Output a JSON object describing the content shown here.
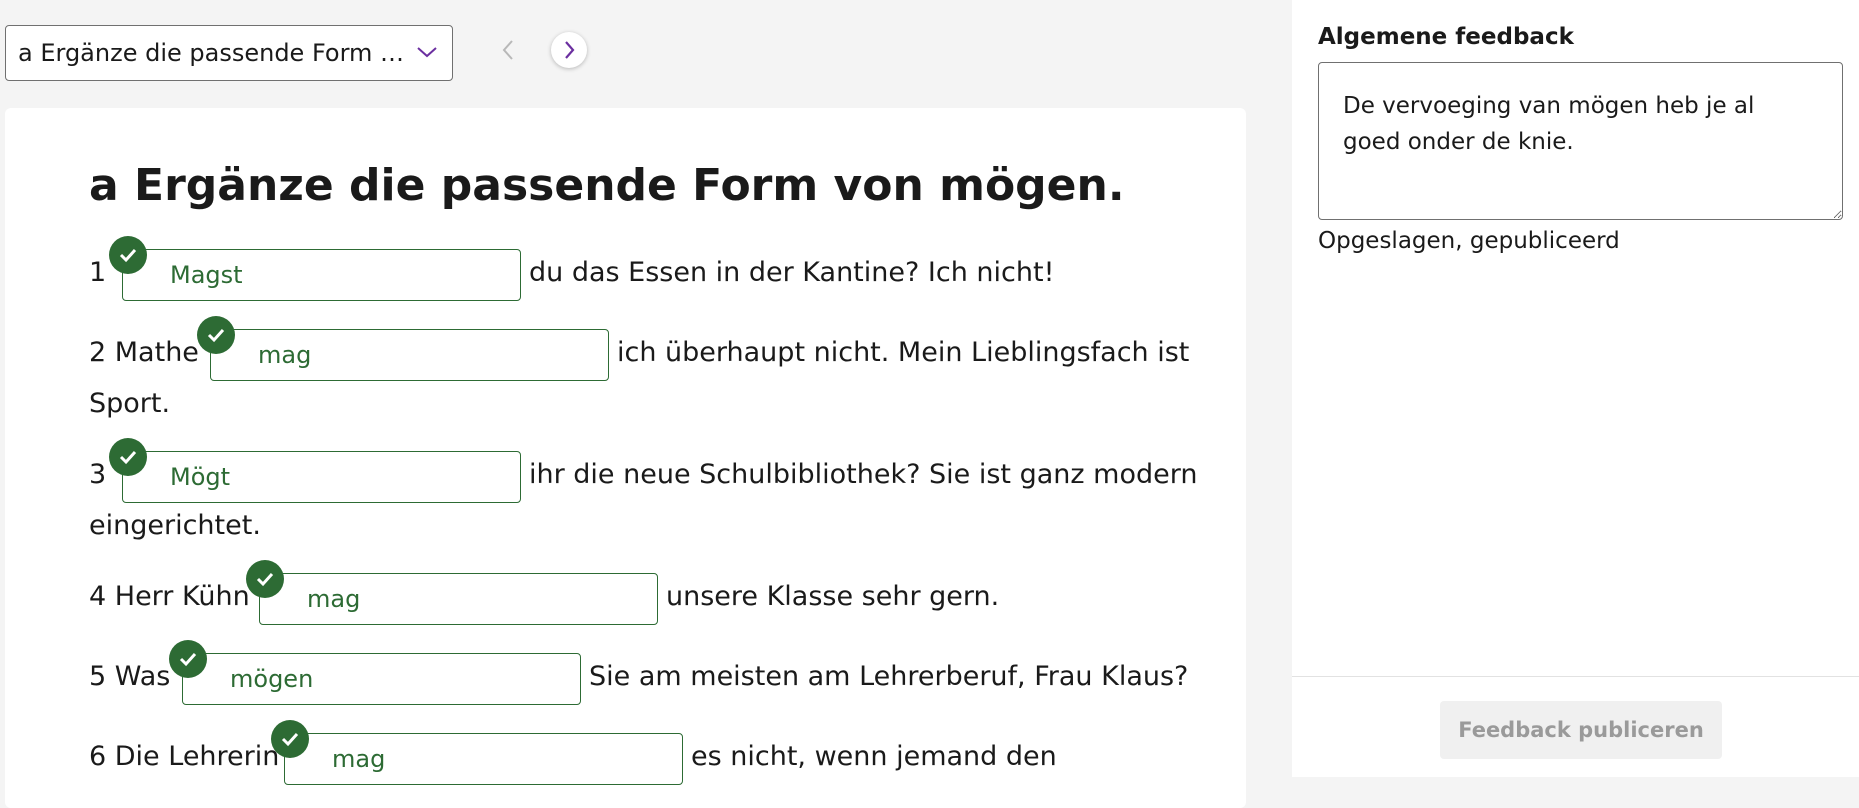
{
  "exercise_selector": {
    "selected": "a Ergänze die passende Form vo..."
  },
  "exercise": {
    "title": "a Ergänze die passende Form von mögen.",
    "items": [
      {
        "prefix": "1",
        "answer": "Magst",
        "suffix": "du das Essen in der Kantine? Ich nicht!",
        "continuation": ""
      },
      {
        "prefix": "2 Mathe",
        "answer": "mag",
        "suffix": "ich überhaupt nicht. Mein Lieblingsfach ist",
        "continuation": "Sport."
      },
      {
        "prefix": "3",
        "answer": "Mögt",
        "suffix": "ihr die neue Schulbibliothek? Sie ist ganz modern",
        "continuation": "eingerichtet."
      },
      {
        "prefix": "4 Herr Kühn",
        "answer": "mag",
        "suffix": "unsere Klasse sehr gern.",
        "continuation": ""
      },
      {
        "prefix": "5 Was",
        "answer": "mögen",
        "suffix": "Sie am meisten am Lehrerberuf, Frau Klaus?",
        "continuation": ""
      },
      {
        "prefix": "6 Die Lehrerin",
        "answer": "mag",
        "suffix": "es nicht, wenn jemand den",
        "continuation": ""
      }
    ]
  },
  "feedback": {
    "label": "Algemene feedback",
    "text": "De vervoeging van mögen heb je al goed onder de knie.",
    "status": "Opgeslagen, gepubliceerd",
    "publish_label": "Feedback publiceren"
  },
  "colors": {
    "correct": "#2d6b34",
    "accent": "#6b2fa0",
    "disabled_text": "#9a9a9a"
  },
  "icons": {
    "dropdown": "chevron-down-icon",
    "previous": "chevron-left-icon",
    "next": "chevron-right-icon",
    "correct": "check-circle-icon"
  }
}
